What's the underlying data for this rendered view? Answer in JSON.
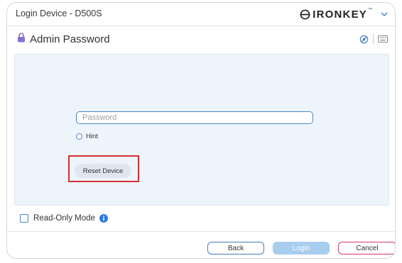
{
  "window": {
    "title": "Login Device - D500S",
    "brand": {
      "name": "IRONKEY",
      "trademark": "™"
    }
  },
  "header": {
    "title": "Admin Password",
    "icons": [
      "lock-icon",
      "eye-slash-icon",
      "keyboard-icon"
    ]
  },
  "form": {
    "password_placeholder": "Password",
    "password_value": "",
    "hint_label": "Hint",
    "reset_label": "Reset Device"
  },
  "options": {
    "readonly_label": "Read-Only Mode",
    "readonly_checked": false
  },
  "footer": {
    "back_label": "Back",
    "login_label": "Login",
    "cancel_label": "Cancel"
  },
  "colors": {
    "accent_blue": "#4a86c8",
    "panel_bg": "#eef4fc",
    "login_disabled": "#a9cdee",
    "cancel_border": "#d63a6a",
    "highlight_red": "#d62f2f",
    "lock_purple": "#8a6fd1",
    "info_blue": "#2d7be0"
  }
}
